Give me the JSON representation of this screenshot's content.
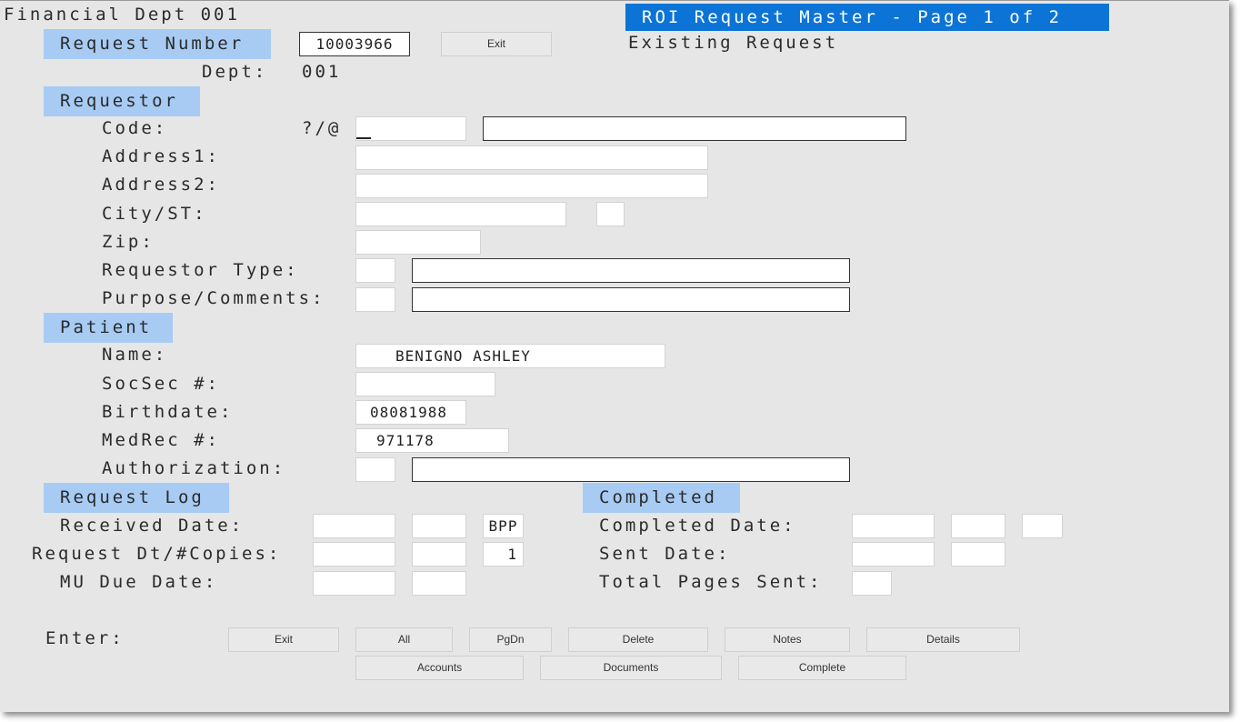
{
  "app_title": "Financial Dept 001",
  "screen_title": "ROI Request Master - Page 1 of 2",
  "request": {
    "header": "Request Number",
    "number": "10003966",
    "exit_label": "Exit",
    "status": "Existing Request",
    "dept_label": "Dept:",
    "dept_value": "001"
  },
  "requestor": {
    "header": "Requestor",
    "code_label": "Code:",
    "code_hint": "?/@",
    "code_value": "",
    "code_name": "",
    "address1_label": "Address1:",
    "address1_value": "",
    "address2_label": "Address2:",
    "address2_value": "",
    "city_label": "City/ST:",
    "city_value": "",
    "state_value": "",
    "zip_label": "Zip:",
    "zip_value": "",
    "type_label": "Requestor Type:",
    "type_code": "",
    "type_desc": "",
    "purpose_label": "Purpose/Comments:",
    "purpose_code": "",
    "purpose_desc": ""
  },
  "patient": {
    "header": "Patient",
    "name_label": "Name:",
    "name_value": "BENIGNO ASHLEY",
    "ssn_label": "SocSec #:",
    "ssn_value": "",
    "birthdate_label": "Birthdate:",
    "birthdate_value": "08081988",
    "medrec_label": "MedRec #:",
    "medrec_value": "971178",
    "auth_label": "Authorization:",
    "auth_code": "",
    "auth_desc": ""
  },
  "request_log": {
    "header": "Request Log",
    "received_label": "Received Date:",
    "received_date": "",
    "received_time": "",
    "received_user": "BPP",
    "request_label": "Request Dt/#Copies:",
    "request_date": "",
    "request_time": "",
    "copies": "1",
    "mu_label": "MU Due Date:",
    "mu_date": "",
    "mu_time": ""
  },
  "completed": {
    "header": "Completed",
    "completed_label": "Completed Date:",
    "completed_date": "",
    "completed_time": "",
    "completed_user": "",
    "sent_label": "Sent Date:",
    "sent_date": "",
    "sent_time": "",
    "pages_label": "Total Pages Sent:",
    "pages_value": ""
  },
  "footer": {
    "enter_label": "Enter:",
    "buttons": {
      "exit": "Exit",
      "all": "All",
      "pgdn": "PgDn",
      "delete": "Delete",
      "notes": "Notes",
      "details": "Details",
      "accounts": "Accounts",
      "documents": "Documents",
      "complete": "Complete"
    }
  }
}
